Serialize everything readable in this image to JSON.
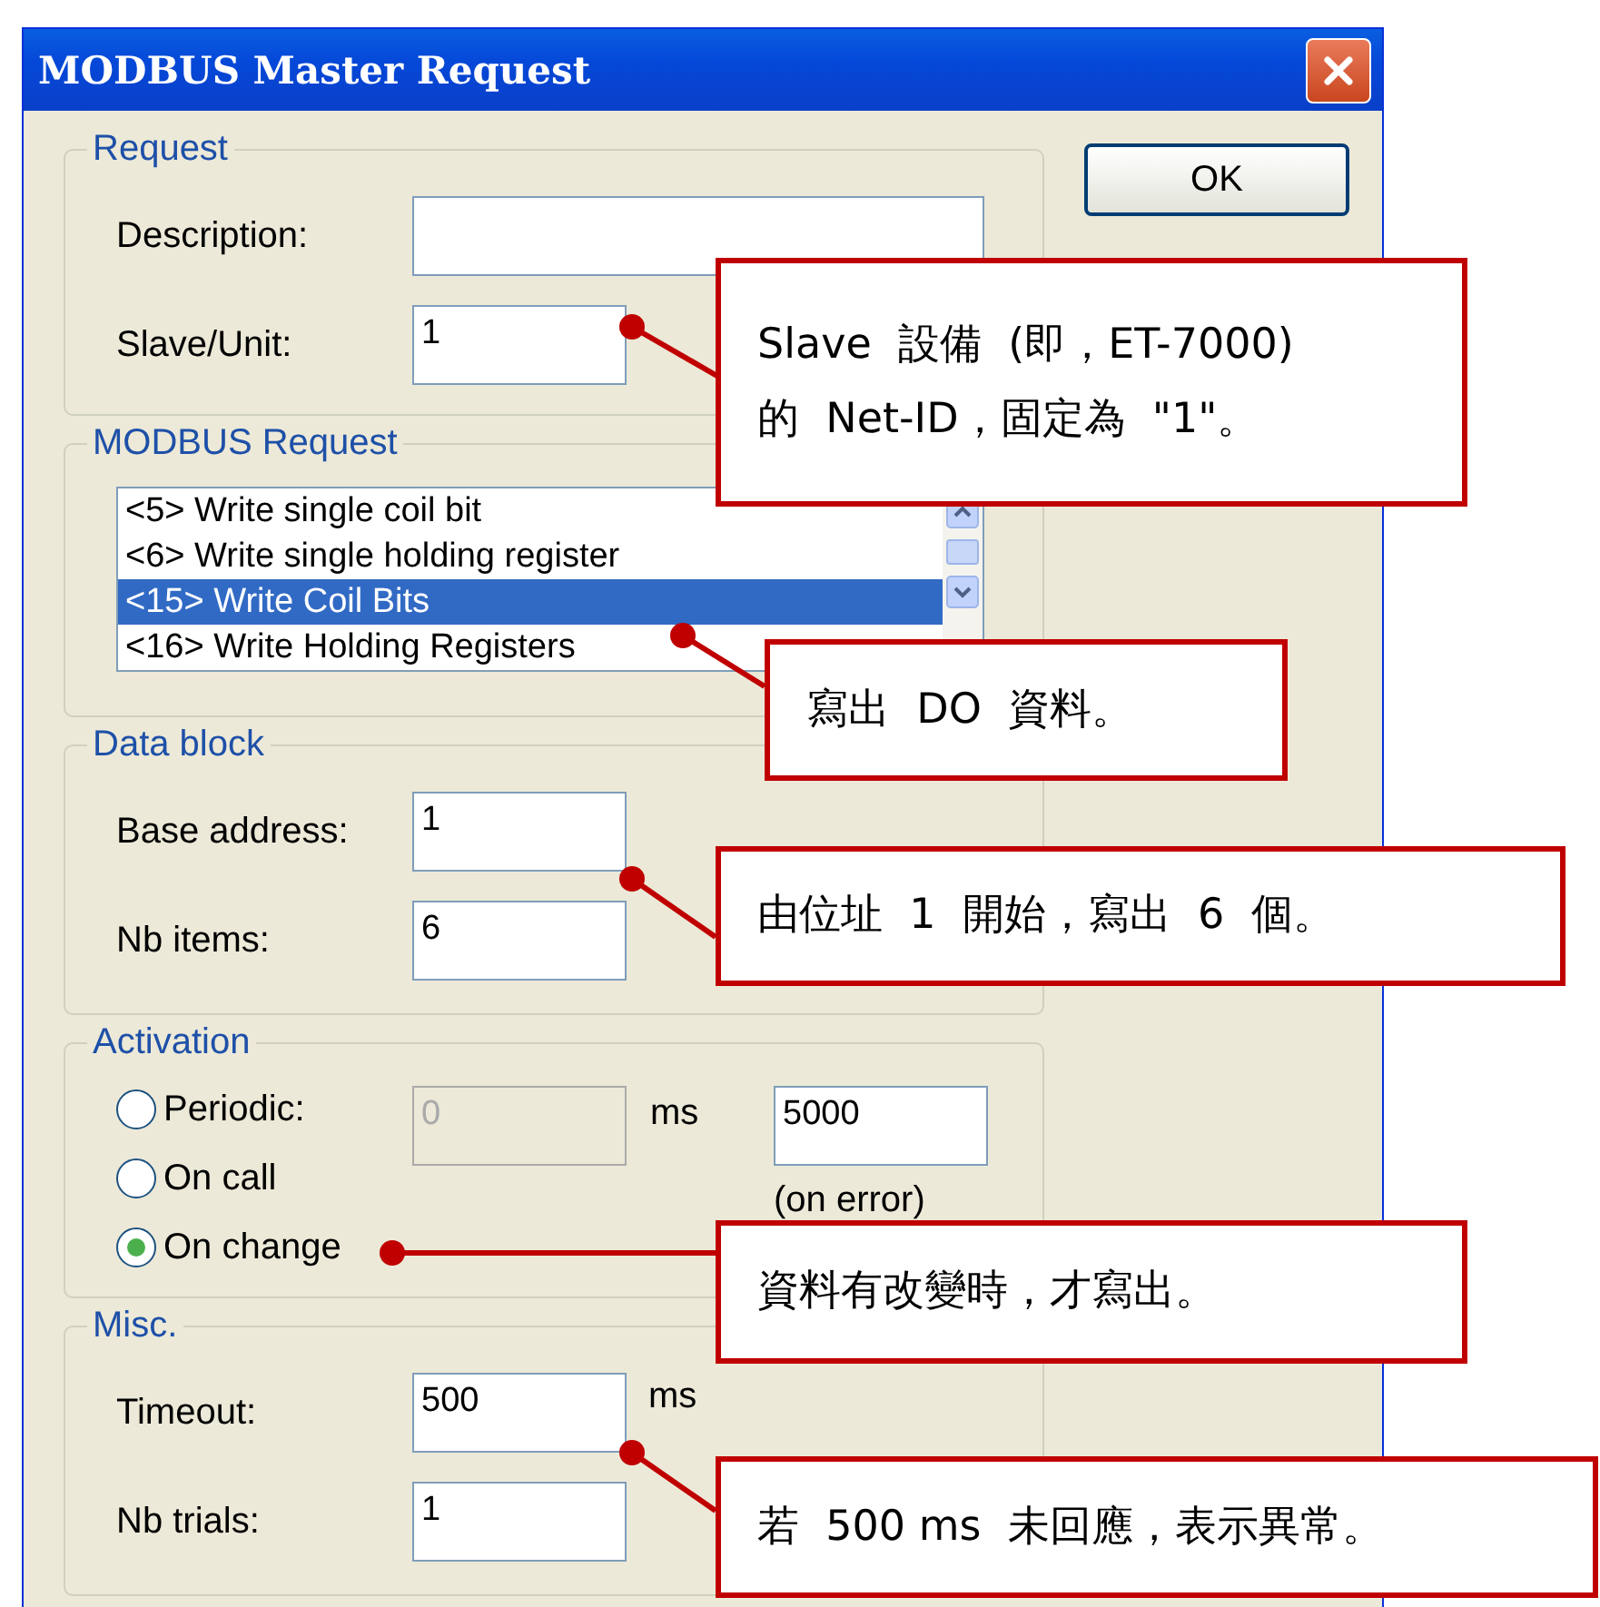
{
  "window": {
    "title": "MODBUS Master Request"
  },
  "ok_button": "OK",
  "request": {
    "legend": "Request",
    "fields": [
      {
        "label": "Description:"
      },
      {
        "label": "Slave/Unit:",
        "value": "1"
      }
    ]
  },
  "modbus_request": {
    "legend": "MODBUS Request",
    "items": [
      {
        "label": "<5> Write single coil bit",
        "selected": false
      },
      {
        "label": "<6> Write single holding register",
        "selected": false
      },
      {
        "label": "<15> Write Coil Bits",
        "selected": true
      },
      {
        "label": "<16> Write Holding Registers",
        "selected": false
      }
    ]
  },
  "data_block": {
    "legend": "Data block",
    "fields": [
      {
        "label": "Base address:",
        "value": "1"
      },
      {
        "label": "Nb items:",
        "value": "6"
      }
    ]
  },
  "activation": {
    "legend": "Activation",
    "options": [
      {
        "label": "Periodic:",
        "selected": false
      },
      {
        "label": "On call",
        "selected": false
      },
      {
        "label": "On change",
        "selected": true
      }
    ],
    "period": {
      "value": "0",
      "disabled": true
    },
    "period_unit": "ms",
    "error_period": {
      "value": "5000"
    },
    "error_note": "(on error)"
  },
  "misc": {
    "legend": "Misc.",
    "timeout": {
      "label": "Timeout:",
      "value": "500",
      "unit": "ms"
    },
    "trials": {
      "label": "Nb trials:",
      "value": "1"
    }
  },
  "callouts": [
    {
      "text": "Slave  設備  (即，ET-7000)\n的  Net-ID，固定為  \"1\"。"
    },
    {
      "text": "寫出  DO  資料。"
    },
    {
      "text": "由位址  1  開始，寫出  6  個。"
    },
    {
      "text": "資料有改變時，才寫出。"
    },
    {
      "text": "若  500 ms  未回應，表示異常。"
    }
  ]
}
